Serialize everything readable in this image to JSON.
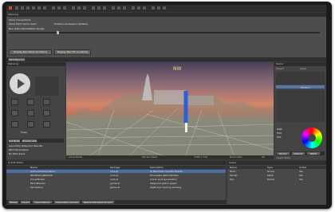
{
  "planning": {
    "title": "Planning",
    "opt1": "Show Connections",
    "opt2": "Show Path Cache Used",
    "opt3": "Enable Live Region Updates",
    "slider_label": "Nav Data Visualization Range",
    "btn1": "Display Nav Mesh Locations",
    "btn2": "Display Nav Hit Locations",
    "tab": "Path Planning"
  },
  "left_panel": {
    "title": "Planning",
    "tabs": [
      "Set Nodes",
      "Breadcrumbs"
    ],
    "list_items": [
      "Geometry Detection Results",
      "Path Parameters"
    ],
    "scale_label": "Scale",
    "note": "No Path Input"
  },
  "viewport": {
    "compass": "NW",
    "status_left": "Show Mode",
    "status_mid": "Terrain Mesh",
    "status_res": "1280 x 720",
    "status_right": "Room Nav",
    "status_fps": "All"
  },
  "right_panel": {
    "title": "Scene",
    "col1": "Object",
    "col2": "Layer",
    "item": "Position",
    "tabs": [
      "Terrain",
      "Objects",
      "Paths"
    ],
    "rgb": [
      "RGB",
      "HSV",
      "HSL"
    ],
    "sub_title": "Layer Tools"
  },
  "bottom": {
    "title": "AI Edit Editor",
    "headers": [
      "Name",
      "Package",
      "Description"
    ],
    "rows": [
      [
        "AutomaticallyCollect",
        "core.ai",
        "AI Navmesh Update Events"
      ],
      [
        "PathfindingBatcher",
        "core.ai",
        "Processes path batches"
      ],
      [
        "CoverFinder",
        "core.ai",
        "Cover spot generation"
      ],
      [
        "PatrolRoutes",
        "game.ai",
        "Waypoint patrol graph"
      ],
      [
        "Perception",
        "game.ai",
        "Sight and hearing sensing"
      ]
    ],
    "tabs": [
      "Nodes",
      "Layers",
      "Associations",
      "Association Groups",
      "Named Package Groups"
    ]
  },
  "bottom_right": {
    "title": "Scene",
    "headers": [
      "Name",
      "Type",
      "Active"
    ],
    "rows": [
      [
        "Root",
        "Group",
        "Yes"
      ],
      [
        "Terrain",
        "Mesh",
        "Yes"
      ],
      [
        "Sky",
        "Dome",
        "Yes"
      ]
    ]
  }
}
